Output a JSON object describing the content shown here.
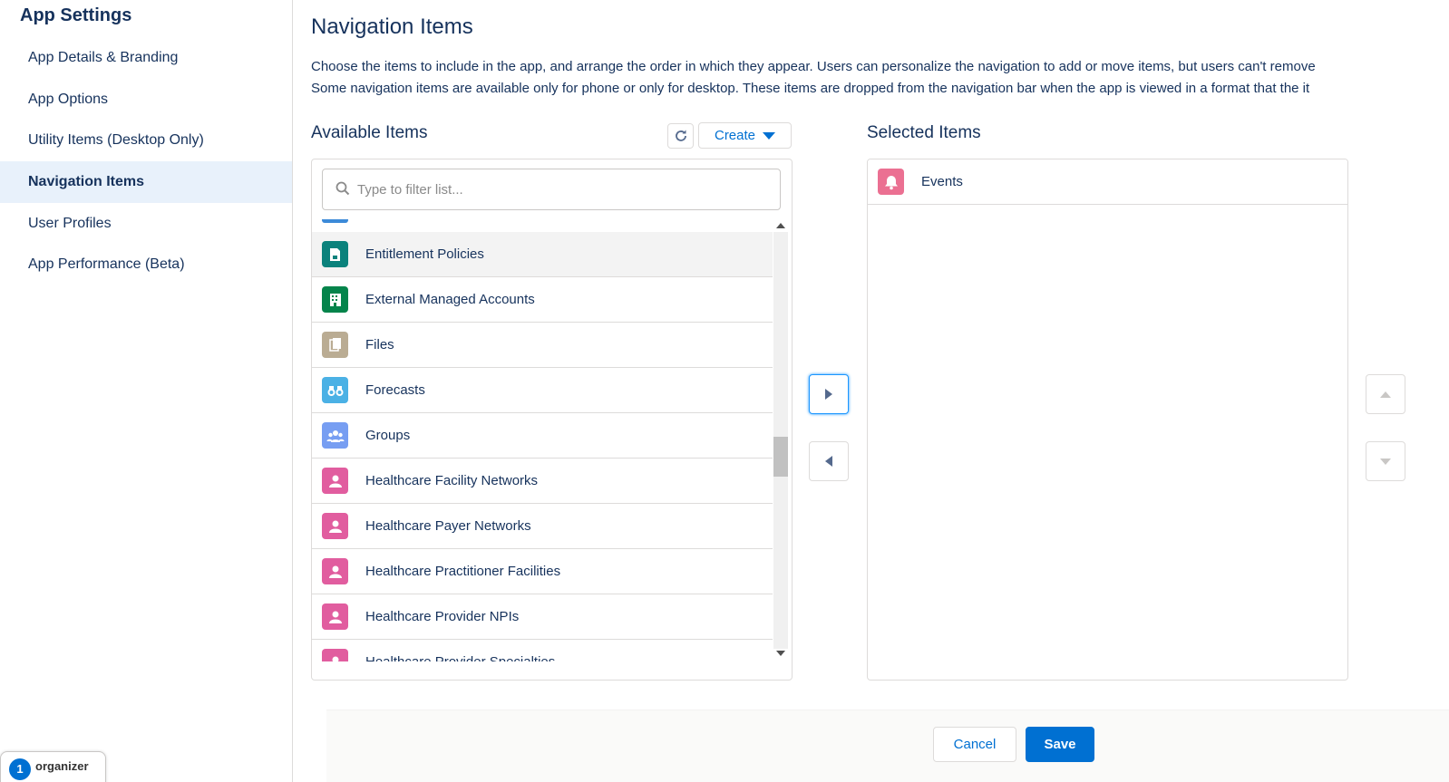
{
  "sidebar": {
    "title": "App Settings",
    "items": [
      {
        "label": "App Details & Branding"
      },
      {
        "label": "App Options"
      },
      {
        "label": "Utility Items (Desktop Only)"
      },
      {
        "label": "Navigation Items",
        "active": true
      },
      {
        "label": "User Profiles"
      },
      {
        "label": "App Performance (Beta)"
      }
    ],
    "organizer": {
      "logo": "1",
      "label": "organizer"
    }
  },
  "main": {
    "title": "Navigation Items",
    "description_line1": "Choose the items to include in the app, and arrange the order in which they appear. Users can personalize the navigation to add or move items, but users can't remove",
    "description_line2": "Some navigation items are available only for phone or only for desktop. These items are dropped from the navigation bar when the app is viewed in a format that the it"
  },
  "available": {
    "title": "Available Items",
    "create_label": "Create",
    "filter_placeholder": "Type to filter list...",
    "items": [
      {
        "label": "Entitlement Policies",
        "icon": "entitlement-policy-icon",
        "color": "#0b827c"
      },
      {
        "label": "External Managed Accounts",
        "icon": "building-icon",
        "color": "#04844b"
      },
      {
        "label": "Files",
        "icon": "file-icon",
        "color": "#baac93"
      },
      {
        "label": "Forecasts",
        "icon": "binoculars-icon",
        "color": "#6bbd6e"
      },
      {
        "label": "Groups",
        "icon": "groups-icon",
        "color": "#779ef2"
      },
      {
        "label": "Healthcare Facility Networks",
        "icon": "contact-icon",
        "color": "#e15d9f"
      },
      {
        "label": "Healthcare Payer Networks",
        "icon": "contact-icon",
        "color": "#e15d9f"
      },
      {
        "label": "Healthcare Practitioner Facilities",
        "icon": "contact-icon",
        "color": "#e15d9f"
      },
      {
        "label": "Healthcare Provider NPIs",
        "icon": "contact-icon",
        "color": "#e15d9f"
      },
      {
        "label": "Healthcare Provider Specialties",
        "icon": "contact-icon",
        "color": "#e15d9f"
      }
    ]
  },
  "selected": {
    "title": "Selected Items",
    "items": [
      {
        "label": "Events",
        "icon": "bell-icon",
        "color": "#eb7092"
      }
    ]
  },
  "footer": {
    "cancel_label": "Cancel",
    "save_label": "Save"
  },
  "colors": {
    "brand": "#0070d2",
    "active_nav_bg": "#e8f1fb",
    "text": "#16325c",
    "forecasts_icon_bg": "#4bb1e5"
  }
}
